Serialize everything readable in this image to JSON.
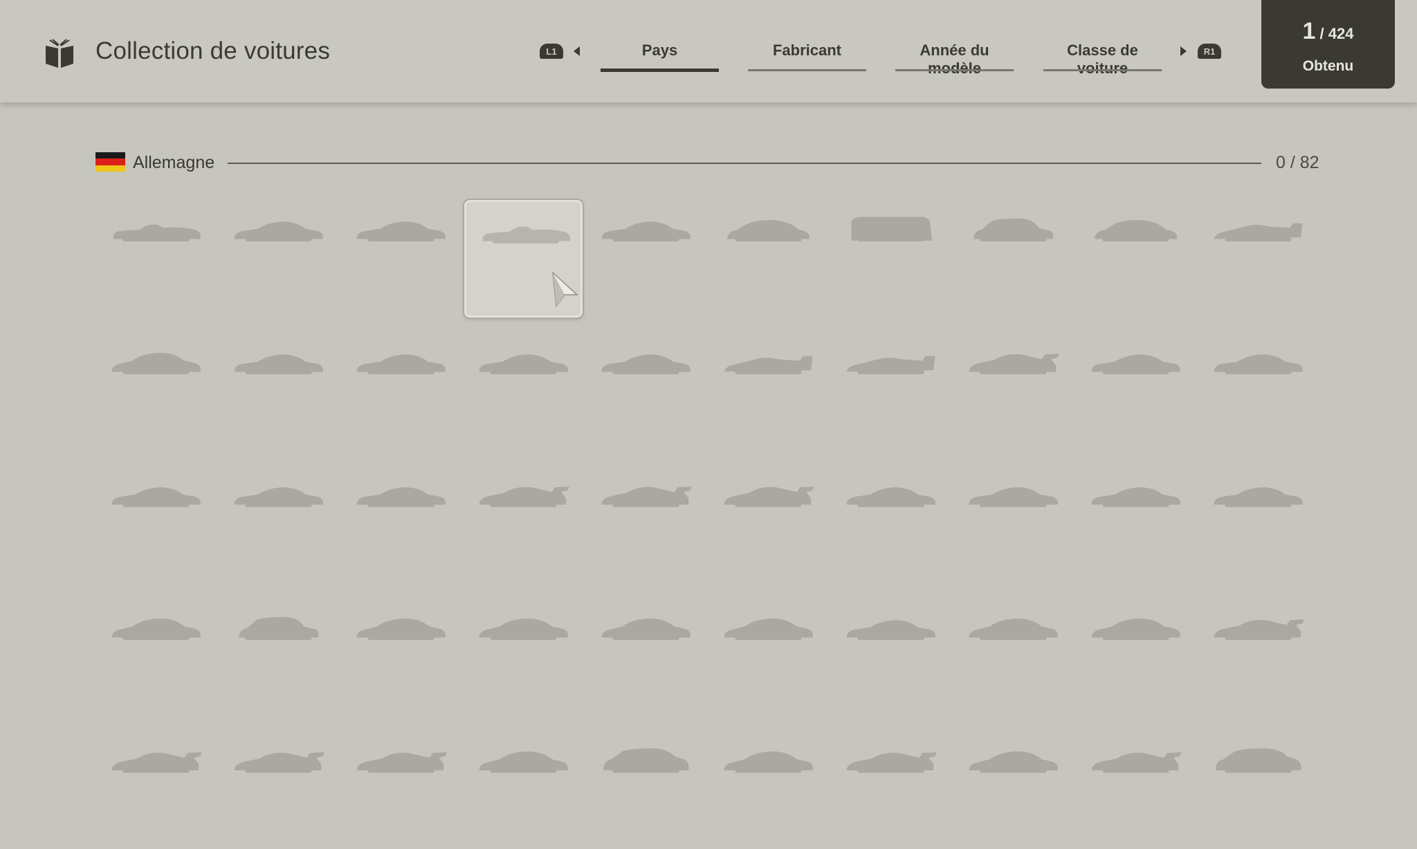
{
  "header": {
    "title": "Collection de voitures",
    "book_icon": "open-book-icon",
    "prev_button": "L1",
    "next_button": "R1",
    "tabs": [
      {
        "label": "Pays",
        "active": true
      },
      {
        "label": "Fabricant",
        "active": false
      },
      {
        "label": "Année du modèle",
        "active": false
      },
      {
        "label": "Classe de voiture",
        "active": false
      }
    ]
  },
  "counter": {
    "owned": "1",
    "total": "/ 424",
    "label": "Obtenu"
  },
  "section": {
    "country": "Allemagne",
    "flag_colors": [
      "#1a1a1a",
      "#dd1f1a",
      "#f0c419"
    ],
    "count": "0 / 82"
  },
  "colors": {
    "silhouette": "#a9a8a1",
    "background": "#c7c6be",
    "dark": "#3a3934"
  },
  "grid": {
    "columns": 10,
    "selected_index": 3,
    "items": [
      "roadster",
      "coupe",
      "coupe",
      "roadster",
      "coupe",
      "beetle",
      "van",
      "hatch",
      "beetle",
      "racer",
      "sedan",
      "coupe",
      "coupe",
      "coupe",
      "coupe",
      "racer",
      "racer",
      "gtwing",
      "coupe",
      "coupe",
      "coupe",
      "coupe",
      "coupe",
      "gtwing",
      "gtwing",
      "gtwing",
      "coupe",
      "coupe",
      "coupe",
      "coupe",
      "sedan",
      "hatch",
      "sedan",
      "sedan",
      "sedan",
      "sedan",
      "coupe",
      "sedan",
      "sedan",
      "gtwing",
      "gtwing",
      "gtwing",
      "gtwing",
      "sedan",
      "suv",
      "sedan",
      "gtwing",
      "sedan",
      "gtwing",
      "suv"
    ]
  }
}
